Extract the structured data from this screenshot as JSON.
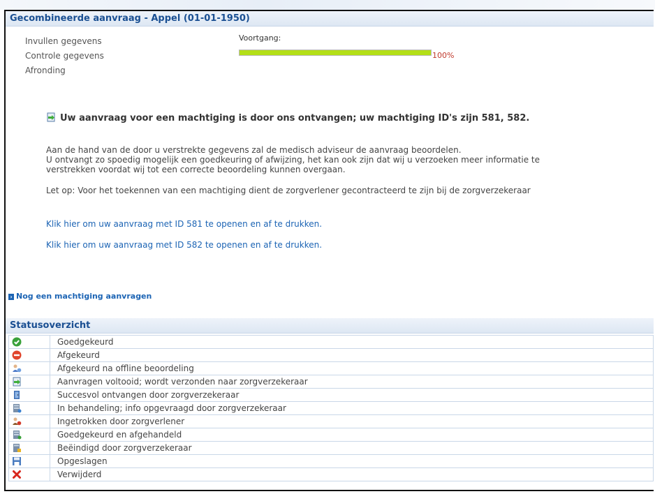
{
  "page": {
    "title": "Gecombineerde aanvraag - Appel (01-01-1950)"
  },
  "steps": [
    {
      "label": "Invullen gegevens"
    },
    {
      "label": "Controle gegevens"
    },
    {
      "label": "Afronding"
    }
  ],
  "progress": {
    "label": "Voortgang:",
    "value": 100,
    "value_text": "100%",
    "color": "#b3df17"
  },
  "message": {
    "heading": "Uw aanvraag voor een machtiging is door ons ontvangen; uw machtiging ID's zijn 581, 582.",
    "heading_icon": "document-send-icon",
    "para1_line1": "Aan de hand van de door u verstrekte gegevens zal de medisch adviseur de aanvraag beoordelen.",
    "para1_line2": "U ontvangt zo spoedig mogelijk een goedkeuring of afwijzing, het kan ook zijn dat wij u verzoeken meer informatie te",
    "para1_line3": "verstrekken voordat wij tot een correcte beoordeling kunnen overgaan.",
    "para2": "Let op: Voor het toekennen van een machtiging dient de zorgverlener gecontracteerd te zijn bij de zorgverzekeraar",
    "link1": "Klik hier om uw aanvraag met ID 581 te openen en af te drukken.",
    "link2": "Klik hier om uw aanvraag met ID 582 te openen en af te drukken."
  },
  "actions": {
    "new_request": "Nog een machtiging aanvragen"
  },
  "status_overview": {
    "title": "Statusoverzicht",
    "items": [
      {
        "icon": "check-circle-icon",
        "label": "Goedgekeurd"
      },
      {
        "icon": "no-entry-icon",
        "label": "Afgekeurd"
      },
      {
        "icon": "person-review-icon",
        "label": "Afgekeurd na offline beoordeling"
      },
      {
        "icon": "document-send-icon",
        "label": "Aanvragen voltooid; wordt verzonden naar zorgverzekeraar"
      },
      {
        "icon": "door-icon",
        "label": "Succesvol ontvangen door zorgverzekeraar"
      },
      {
        "icon": "server-info-icon",
        "label": "In behandeling; info opgevraagd door zorgverzekeraar"
      },
      {
        "icon": "person-withdraw-icon",
        "label": "Ingetrokken door zorgverlener"
      },
      {
        "icon": "server-approved-icon",
        "label": "Goedgekeurd en afgehandeld"
      },
      {
        "icon": "server-lock-icon",
        "label": "Beëindigd door zorgverzekeraar"
      },
      {
        "icon": "floppy-disk-icon",
        "label": "Opgeslagen"
      },
      {
        "icon": "red-cross-icon",
        "label": "Verwijderd"
      }
    ]
  }
}
